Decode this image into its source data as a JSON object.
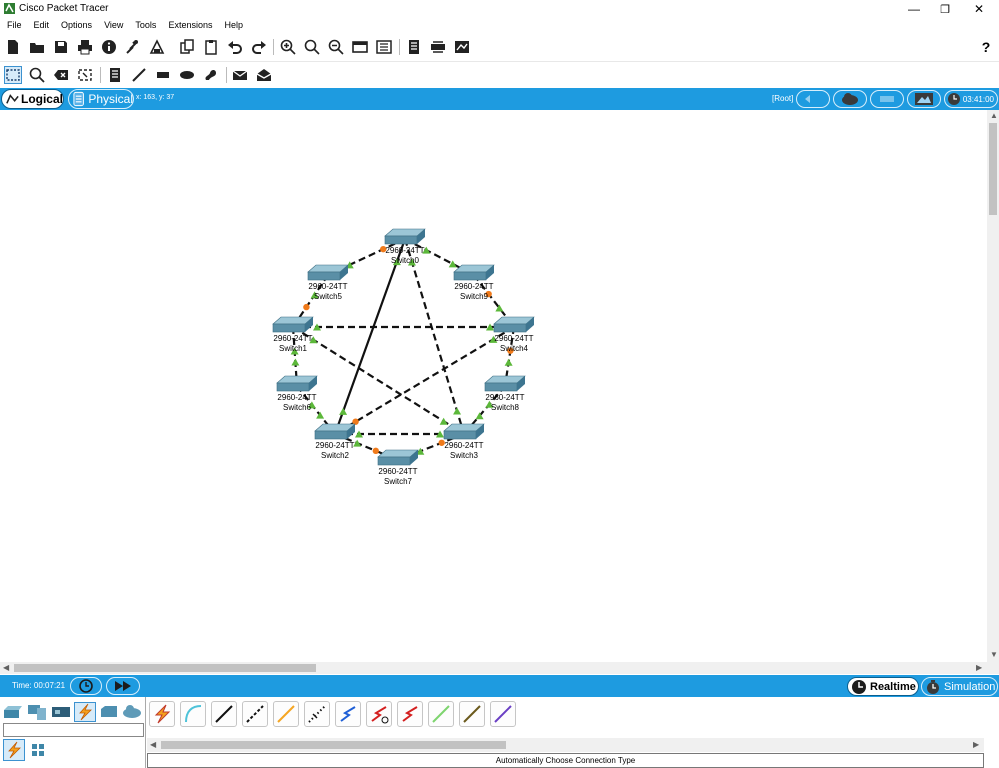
{
  "window": {
    "title": "Cisco Packet Tracer",
    "minimize_glyph": "—",
    "restore_glyph": "❐",
    "close_glyph": "✕"
  },
  "menu": [
    "File",
    "Edit",
    "Options",
    "View",
    "Tools",
    "Extensions",
    "Help"
  ],
  "toolbar_main": {
    "icons": [
      "new-file-icon",
      "open-folder-icon",
      "save-icon",
      "print-icon",
      "info-icon",
      "activity-wizard-icon",
      "custom-device-icon",
      "copy-icon",
      "paste-icon",
      "undo-icon",
      "redo-icon",
      "zoom-in-icon",
      "zoom-reset-icon",
      "zoom-out-icon",
      "drawing-palette-icon",
      "custom-devices-dialog-icon",
      "viewport-icon",
      "network-info-icon",
      "cluster-icon"
    ],
    "help": "?"
  },
  "toolbar_tools": [
    "select-icon",
    "inspect-icon",
    "delete-icon",
    "resize-icon",
    "note-icon",
    "line-icon",
    "rectangle-icon",
    "ellipse-icon",
    "freeform-icon",
    "simple-pdu-icon",
    "complex-pdu-icon"
  ],
  "modebar": {
    "logical": "Logical",
    "physical": "Physical",
    "coords": "x: 163, y: 37",
    "root": "[Root]",
    "clock": "03:41:00"
  },
  "topology": {
    "devices": [
      {
        "model": "2960-24TT",
        "name": "Switch0"
      },
      {
        "model": "2960-24TT",
        "name": "Switch5"
      },
      {
        "model": "2960-24TT",
        "name": "Switch9"
      },
      {
        "model": "2960-24TT",
        "name": "Switch1"
      },
      {
        "model": "2960-24TT",
        "name": "Switch4"
      },
      {
        "model": "2960-24TT",
        "name": "Switch6"
      },
      {
        "model": "2960-24TT",
        "name": "Switch8"
      },
      {
        "model": "2960-24TT",
        "name": "Switch2"
      },
      {
        "model": "2960-24TT",
        "name": "Switch3"
      },
      {
        "model": "2960-24TT",
        "name": "Switch7"
      }
    ],
    "colors": {
      "link_up": "#5cb83a",
      "link_blocking": "#f07a1a",
      "switch_body": "#5a8fa6",
      "switch_top": "#9cc6d6"
    }
  },
  "timebar": {
    "time": "Time: 00:07:21",
    "realtime": "Realtime",
    "simulation": "Simulation"
  },
  "device_panel": {
    "categories": [
      "network-devices-icon",
      "end-devices-icon",
      "components-icon",
      "connections-icon",
      "miscellaneous-icon",
      "multiuser-icon"
    ],
    "search_value": "",
    "subcategories": [
      "connections-icon",
      "grid-icon"
    ]
  },
  "connections": {
    "types": [
      "automatic-icon",
      "console-icon",
      "copper-straight-icon",
      "copper-cross-icon",
      "fiber-icon",
      "phone-icon",
      "coaxial-icon",
      "serial-dce-icon",
      "serial-dte-icon",
      "octal-icon",
      "iot-custom-icon",
      "usb-icon"
    ],
    "status": "Automatically Choose Connection Type"
  }
}
